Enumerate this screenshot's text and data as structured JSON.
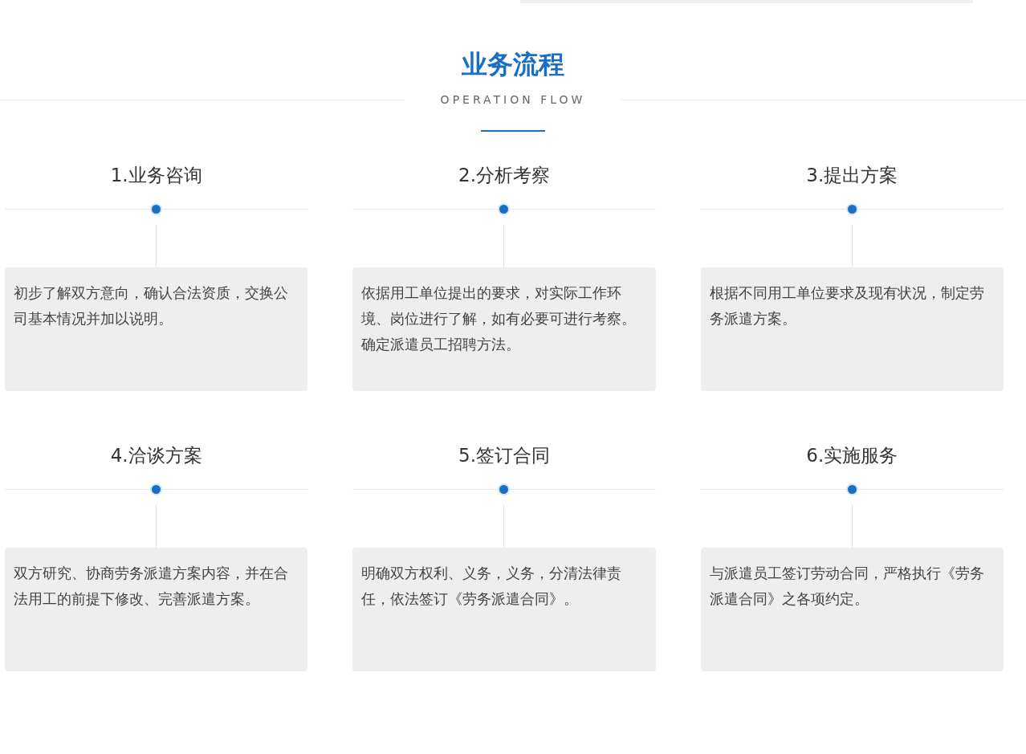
{
  "heading": {
    "title": "业务流程",
    "subtitle": "OPERATION FLOW"
  },
  "steps": [
    {
      "title": "1.业务咨询",
      "text": "初步了解双方意向，确认合法资质，交换公司基本情况并加以说明。"
    },
    {
      "title": "2.分析考察",
      "text": "依据用工单位提出的要求，对实际工作环境、岗位进行了解，如有必要可进行考察。确定派遣员工招聘方法。"
    },
    {
      "title": "3.提出方案",
      "text": "根据不同用工单位要求及现有状况，制定劳务派遣方案。"
    },
    {
      "title": "4.洽谈方案",
      "text": "双方研究、协商劳务派遣方案内容，并在合法用工的前提下修改、完善派遣方案。"
    },
    {
      "title": "5.签订合同",
      "text": "明确双方权利、义务，义务，分清法律责任，依法签订《劳务派遣合同》。"
    },
    {
      "title": "6.实施服务",
      "text": "与派遣员工签订劳动合同，严格执行《劳务派遣合同》之各项约定。"
    }
  ]
}
